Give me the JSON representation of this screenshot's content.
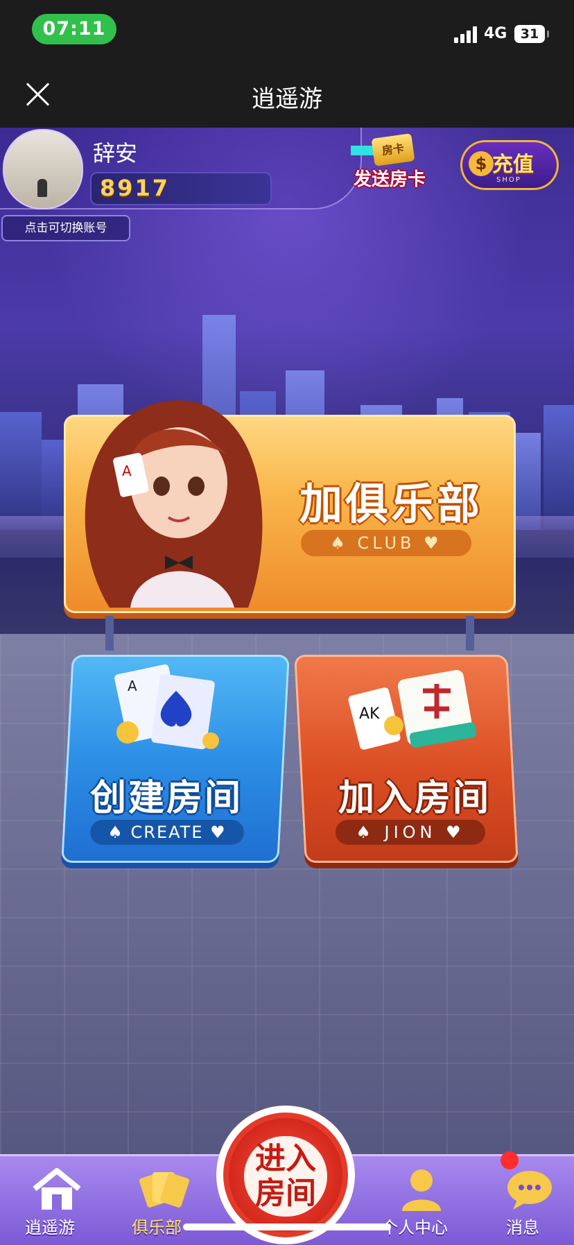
{
  "status_bar": {
    "time": "07:11",
    "network": "4G",
    "battery": "31"
  },
  "nav": {
    "title": "逍遥游"
  },
  "user": {
    "name": "辞安",
    "coins": "8917",
    "switch_account": "点击可切换账号"
  },
  "header_buttons": {
    "send_card_card": "房卡",
    "send_card": "发送房卡",
    "recharge": "充值",
    "recharge_sub": "SHOP"
  },
  "club": {
    "title": "加俱乐部",
    "subtitle": "♠ CLUB ♥"
  },
  "create_room": {
    "title": "创建房间",
    "subtitle": "♠ CREATE ♥"
  },
  "join_room": {
    "title": "加入房间",
    "subtitle": "♠ JION ♥"
  },
  "bottom_nav": {
    "items": [
      {
        "label": "逍遥游",
        "icon": "home-icon"
      },
      {
        "label": "俱乐部",
        "icon": "cards-icon"
      },
      {
        "label": "个人中心",
        "icon": "person-icon"
      },
      {
        "label": "消息",
        "icon": "chat-icon"
      }
    ],
    "center": "进入房间"
  },
  "colors": {
    "status_green": "#31c04c",
    "club_orange": "#f9b64b",
    "create_blue": "#2d8fe6",
    "join_red": "#db4e24",
    "nav_purple": "#a889ee"
  }
}
